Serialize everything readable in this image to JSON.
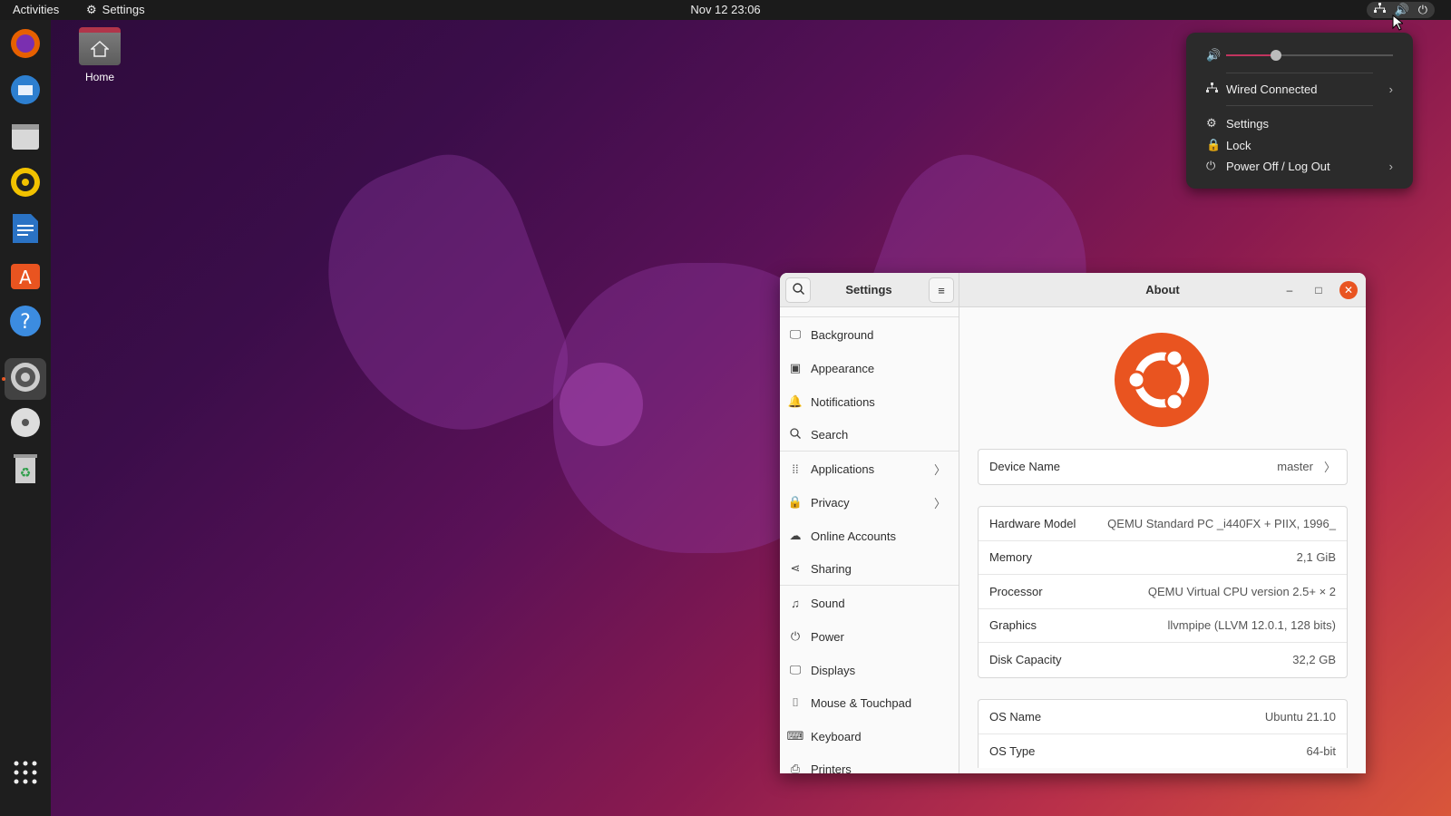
{
  "topbar": {
    "activities": "Activities",
    "app_menu": "Settings",
    "clock": "Nov 12  23:06"
  },
  "desktop": {
    "home_label": "Home"
  },
  "status_menu": {
    "volume_percent": 30,
    "network": "Wired Connected",
    "settings": "Settings",
    "lock": "Lock",
    "power": "Power Off / Log Out"
  },
  "settings_window": {
    "sidebar_title": "Settings",
    "page_title": "About",
    "sidebar_items": [
      {
        "label": "Background",
        "icon": "monitor-icon"
      },
      {
        "label": "Appearance",
        "icon": "appearance-icon"
      },
      {
        "label": "Notifications",
        "icon": "bell-icon"
      },
      {
        "label": "Search",
        "icon": "search-icon"
      },
      {
        "label": "Applications",
        "icon": "apps-grid-icon"
      },
      {
        "label": "Privacy",
        "icon": "lock-icon"
      },
      {
        "label": "Online Accounts",
        "icon": "cloud-icon"
      },
      {
        "label": "Sharing",
        "icon": "share-icon"
      },
      {
        "label": "Sound",
        "icon": "music-note-icon"
      },
      {
        "label": "Power",
        "icon": "power-icon"
      },
      {
        "label": "Displays",
        "icon": "display-icon"
      },
      {
        "label": "Mouse & Touchpad",
        "icon": "mouse-icon"
      },
      {
        "label": "Keyboard",
        "icon": "keyboard-icon"
      },
      {
        "label": "Printers",
        "icon": "printer-icon"
      }
    ],
    "device": {
      "label": "Device Name",
      "value": "master"
    },
    "hardware": [
      {
        "label": "Hardware Model",
        "value": "QEMU Standard PC _i440FX + PIIX, 1996_"
      },
      {
        "label": "Memory",
        "value": "2,1 GiB"
      },
      {
        "label": "Processor",
        "value": "QEMU Virtual CPU version 2.5+ × 2"
      },
      {
        "label": "Graphics",
        "value": "llvmpipe (LLVM 12.0.1, 128 bits)"
      },
      {
        "label": "Disk Capacity",
        "value": "32,2 GB"
      }
    ],
    "os": [
      {
        "label": "OS Name",
        "value": "Ubuntu 21.10"
      },
      {
        "label": "OS Type",
        "value": "64-bit"
      }
    ]
  },
  "colors": {
    "accent": "#e95420",
    "panel": "#1b1b1b",
    "dock": "#1e1e1e"
  }
}
